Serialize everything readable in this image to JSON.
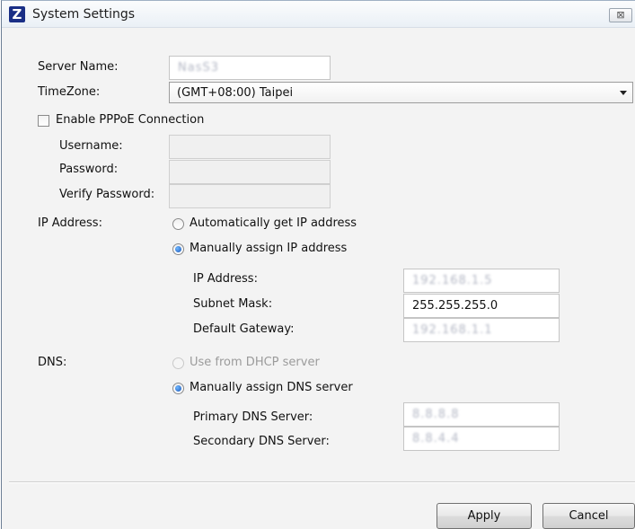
{
  "window": {
    "title": "System Settings",
    "close_symbol": "⊠"
  },
  "server": {
    "label": "Server Name:",
    "value": "NasS3"
  },
  "timezone": {
    "label": "TimeZone:",
    "selected": "(GMT+08:00) Taipei"
  },
  "pppoe": {
    "checkbox_label": "Enable PPPoE Connection",
    "checked": false,
    "username_label": "Username:",
    "password_label": "Password:",
    "verify_label": "Verify Password:"
  },
  "ip": {
    "section_label": "IP Address:",
    "auto_option": "Automatically get IP address",
    "manual_option": "Manually assign IP address",
    "ip_label": "IP Address:",
    "ip_value": "192.168.1.5",
    "subnet_label": "Subnet Mask:",
    "subnet_value": "255.255.255.0",
    "gateway_label": "Default Gateway:",
    "gateway_value": "192.168.1.1"
  },
  "dns": {
    "section_label": "DNS:",
    "dhcp_option": "Use from DHCP server",
    "manual_option": "Manually assign DNS server",
    "primary_label": "Primary DNS Server:",
    "primary_value": "8.8.8.8",
    "secondary_label": "Secondary DNS Server:",
    "secondary_value": "8.8.4.4"
  },
  "buttons": {
    "apply": "Apply",
    "cancel": "Cancel"
  }
}
